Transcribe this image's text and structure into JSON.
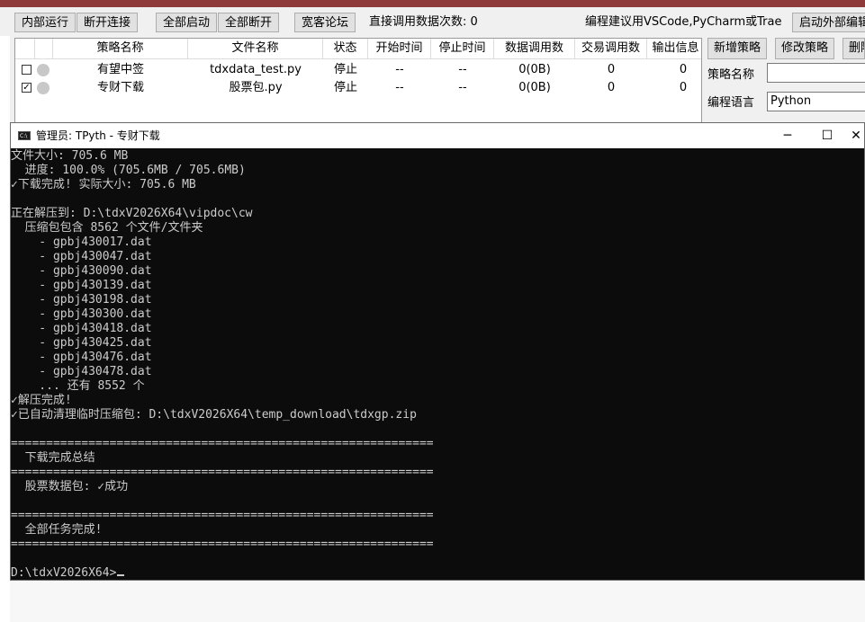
{
  "outer_window": {
    "title": ""
  },
  "toolbar": {
    "buttons": [
      "内部运行",
      "断开连接",
      "全部启动",
      "全部断开",
      "宽客论坛"
    ],
    "call_count_label": "直接调用数据次数: 0",
    "ide_hint": "编程建议用VSCode,PyCharm或Trae",
    "external_editor_button": "启动外部编辑"
  },
  "strategy_table": {
    "columns": [
      "策略名称",
      "文件名称",
      "状态",
      "开始时间",
      "停止时间",
      "数据调用数",
      "交易调用数",
      "输出信息"
    ],
    "rows": [
      {
        "checked": false,
        "name": "有望中签",
        "file": "tdxdata_test.py",
        "status": "停止",
        "start": "--",
        "stop": "--",
        "data_calls": "0(0B)",
        "trade_calls": "0",
        "output": "0"
      },
      {
        "checked": true,
        "name": "专财下载",
        "file": "股票包.py",
        "status": "停止",
        "start": "--",
        "stop": "--",
        "data_calls": "0(0B)",
        "trade_calls": "0",
        "output": "0"
      }
    ]
  },
  "right_panel": {
    "add_button": "新增策略",
    "modify_button": "修改策略",
    "delete_button": "删除",
    "name_label": "策略名称",
    "name_value": "",
    "lang_label": "编程语言",
    "lang_value": "Python"
  },
  "console": {
    "title": "管理员: TPyth - 专财下载",
    "icon_text": "C:\\",
    "lines": [
      "文件大小: 705.6 MB",
      "  进度: 100.0% (705.6MB / 705.6MB)",
      "✓下载完成! 实际大小: 705.6 MB",
      "",
      "正在解压到: D:\\tdxV2026X64\\vipdoc\\cw",
      "  压缩包包含 8562 个文件/文件夹",
      "    - gpbj430017.dat",
      "    - gpbj430047.dat",
      "    - gpbj430090.dat",
      "    - gpbj430139.dat",
      "    - gpbj430198.dat",
      "    - gpbj430300.dat",
      "    - gpbj430418.dat",
      "    - gpbj430425.dat",
      "    - gpbj430476.dat",
      "    - gpbj430478.dat",
      "    ... 还有 8552 个",
      "✓解压完成!",
      "✓已自动清理临时压缩包: D:\\tdxV2026X64\\temp_download\\tdxgp.zip",
      "",
      "============================================================",
      "  下载完成总结",
      "============================================================",
      "  股票数据包: ✓成功",
      "",
      "============================================================",
      "  全部任务完成!",
      "============================================================",
      "",
      "D:\\tdxV2026X64>"
    ]
  }
}
